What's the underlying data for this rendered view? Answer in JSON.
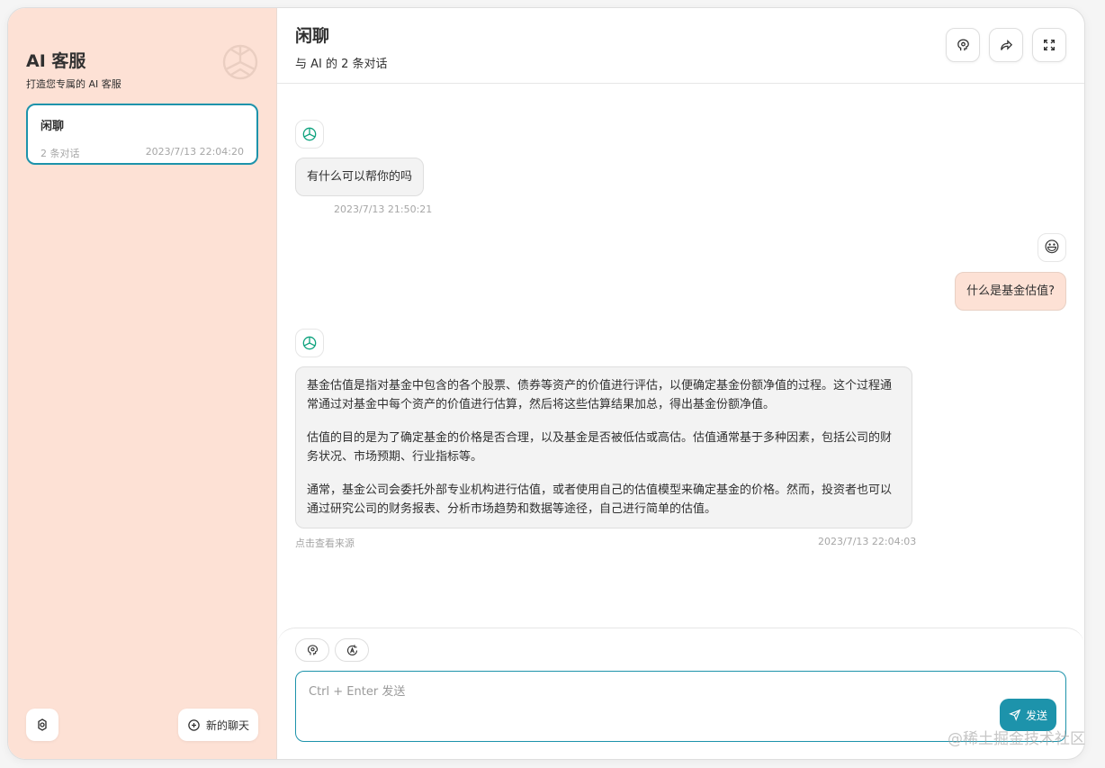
{
  "sidebar": {
    "title": "AI 客服",
    "subtitle": "打造您专属的 AI 客服",
    "chats": [
      {
        "title": "闲聊",
        "count": "2 条对话",
        "time": "2023/7/13 22:04:20"
      }
    ],
    "new_chat_label": "新的聊天"
  },
  "header": {
    "title": "闲聊",
    "subtitle": "与 AI 的 2 条对话"
  },
  "messages": [
    {
      "role": "bot",
      "text": "有什么可以帮你的吗",
      "time": "2023/7/13 21:50:21"
    },
    {
      "role": "user",
      "avatar": "😃",
      "text": "什么是基金估值?"
    },
    {
      "role": "bot",
      "paragraphs": [
        "基金估值是指对基金中包含的各个股票、债券等资产的价值进行评估，以便确定基金份额净值的过程。这个过程通常通过对基金中每个资产的价值进行估算，然后将这些估算结果加总，得出基金份额净值。",
        "估值的目的是为了确定基金的价格是否合理，以及基金是否被低估或高估。估值通常基于多种因素，包括公司的财务状况、市场预期、行业指标等。",
        "通常，基金公司会委托外部专业机构进行估值，或者使用自己的估值模型来确定基金的价格。然而，投资者也可以通过研究公司的财务报表、分析市场趋势和数据等途径，自己进行简单的估值。"
      ],
      "source_link": "点击查看来源",
      "time": "2023/7/13 22:04:03"
    }
  ],
  "input": {
    "placeholder": "Ctrl + Enter 发送",
    "send_label": "发送"
  },
  "watermark": "@稀土掘金技术社区",
  "colors": {
    "accent": "#1d93ab",
    "sidebar_bg": "#fde1d5"
  }
}
